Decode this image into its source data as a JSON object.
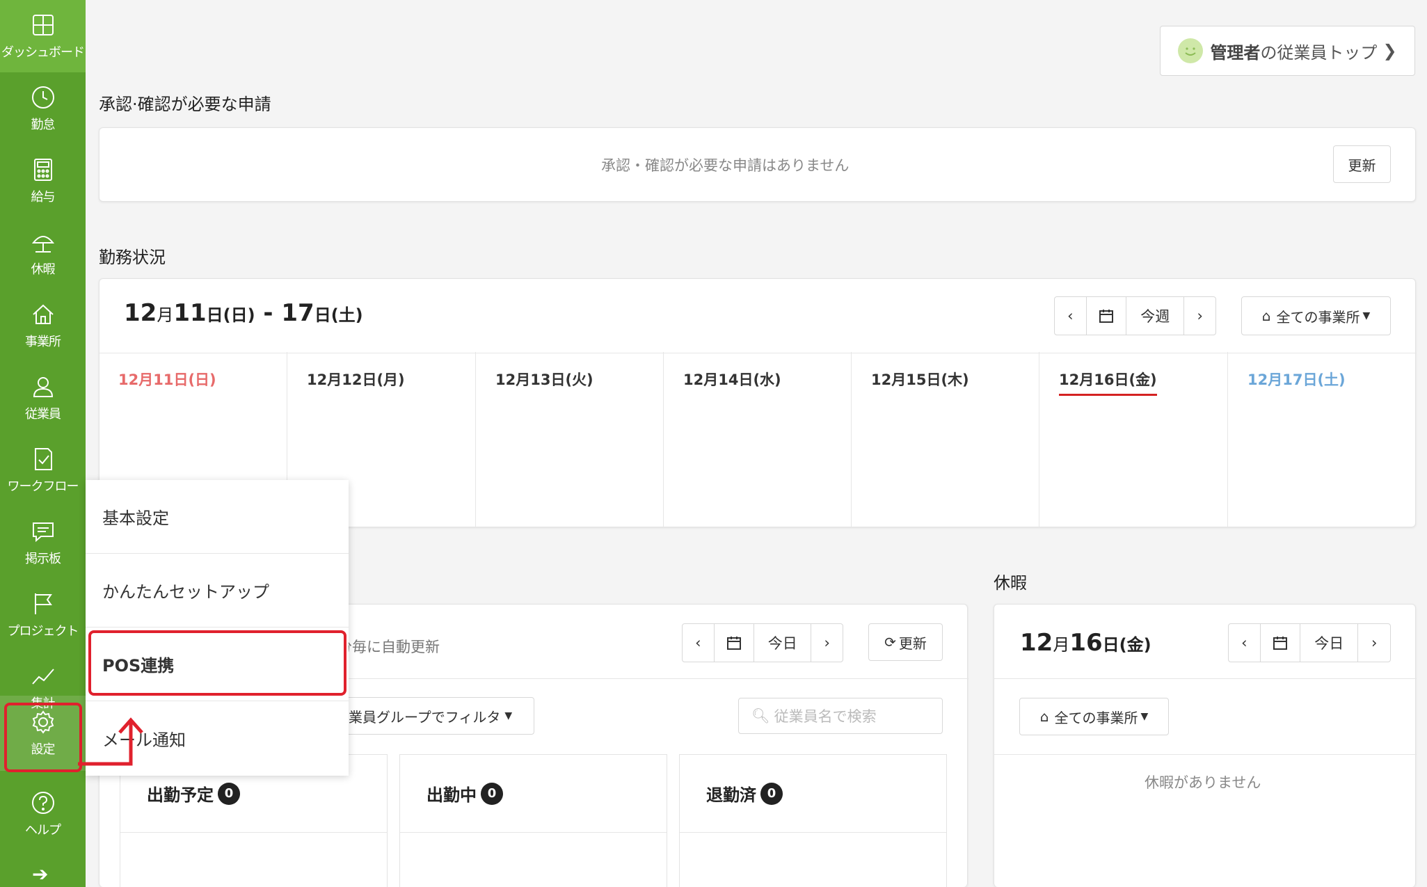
{
  "sidebar": {
    "items": [
      {
        "label": "ダッシュボード",
        "icon": "dashboard-icon"
      },
      {
        "label": "勤怠",
        "icon": "clock-icon"
      },
      {
        "label": "給与",
        "icon": "calculator-icon"
      },
      {
        "label": "休暇",
        "icon": "umbrella-icon"
      },
      {
        "label": "事業所",
        "icon": "home-icon"
      },
      {
        "label": "従業員",
        "icon": "user-icon"
      },
      {
        "label": "ワークフロー",
        "icon": "checklist-icon"
      },
      {
        "label": "掲示板",
        "icon": "chat-icon"
      },
      {
        "label": "プロジェクト",
        "icon": "flag-icon"
      },
      {
        "label": "集計",
        "icon": "chart-line-icon"
      },
      {
        "label": "設定",
        "icon": "gear-icon"
      },
      {
        "label": "ヘルプ",
        "icon": "help-icon"
      }
    ]
  },
  "header": {
    "admin_button_bold": "管理者",
    "admin_button_rest": "の従業員トップ"
  },
  "approvals": {
    "title": "承認·確認が必要な申請",
    "empty": "承認・確認が必要な申請はありません",
    "refresh": "更新"
  },
  "work_status": {
    "title": "勤務状況",
    "range": {
      "m1": "12",
      "mo": "月",
      "d1": "11",
      "w1": "日(日)",
      "dash": " - ",
      "d2": "17",
      "w2": "日(土)"
    },
    "this_week": "今週",
    "office_filter": "全ての事業所",
    "days": [
      "12月11日(日)",
      "12月12日(月)",
      "12月13日(火)",
      "12月14日(水)",
      "12月15日(木)",
      "12月16日(金)",
      "12月17日(土)"
    ]
  },
  "attendance": {
    "auto_refresh": "分毎に自動更新",
    "today": "今日",
    "refresh": "更新",
    "group_filter": "業員グループでフィルタ",
    "search_placeholder": "従業員名で検索",
    "cols": [
      {
        "label": "出勤予定",
        "count": "0"
      },
      {
        "label": "出勤中",
        "count": "0"
      },
      {
        "label": "退勤済",
        "count": "0"
      }
    ]
  },
  "leave": {
    "title": "休暇",
    "date_big": "12",
    "date_mo": "月",
    "date_day": "16",
    "date_rest": "日(金)",
    "today": "今日",
    "office_filter": "全ての事業所",
    "empty": "休暇がありません"
  },
  "settings_menu": {
    "items": [
      "基本設定",
      "かんたんセットアップ",
      "POS連携",
      "メール通知"
    ]
  },
  "colors": {
    "sidebar": "#5aa02c",
    "highlight": "#e0212d",
    "sunday": "#e76a6a",
    "saturday": "#6ba6d8"
  }
}
